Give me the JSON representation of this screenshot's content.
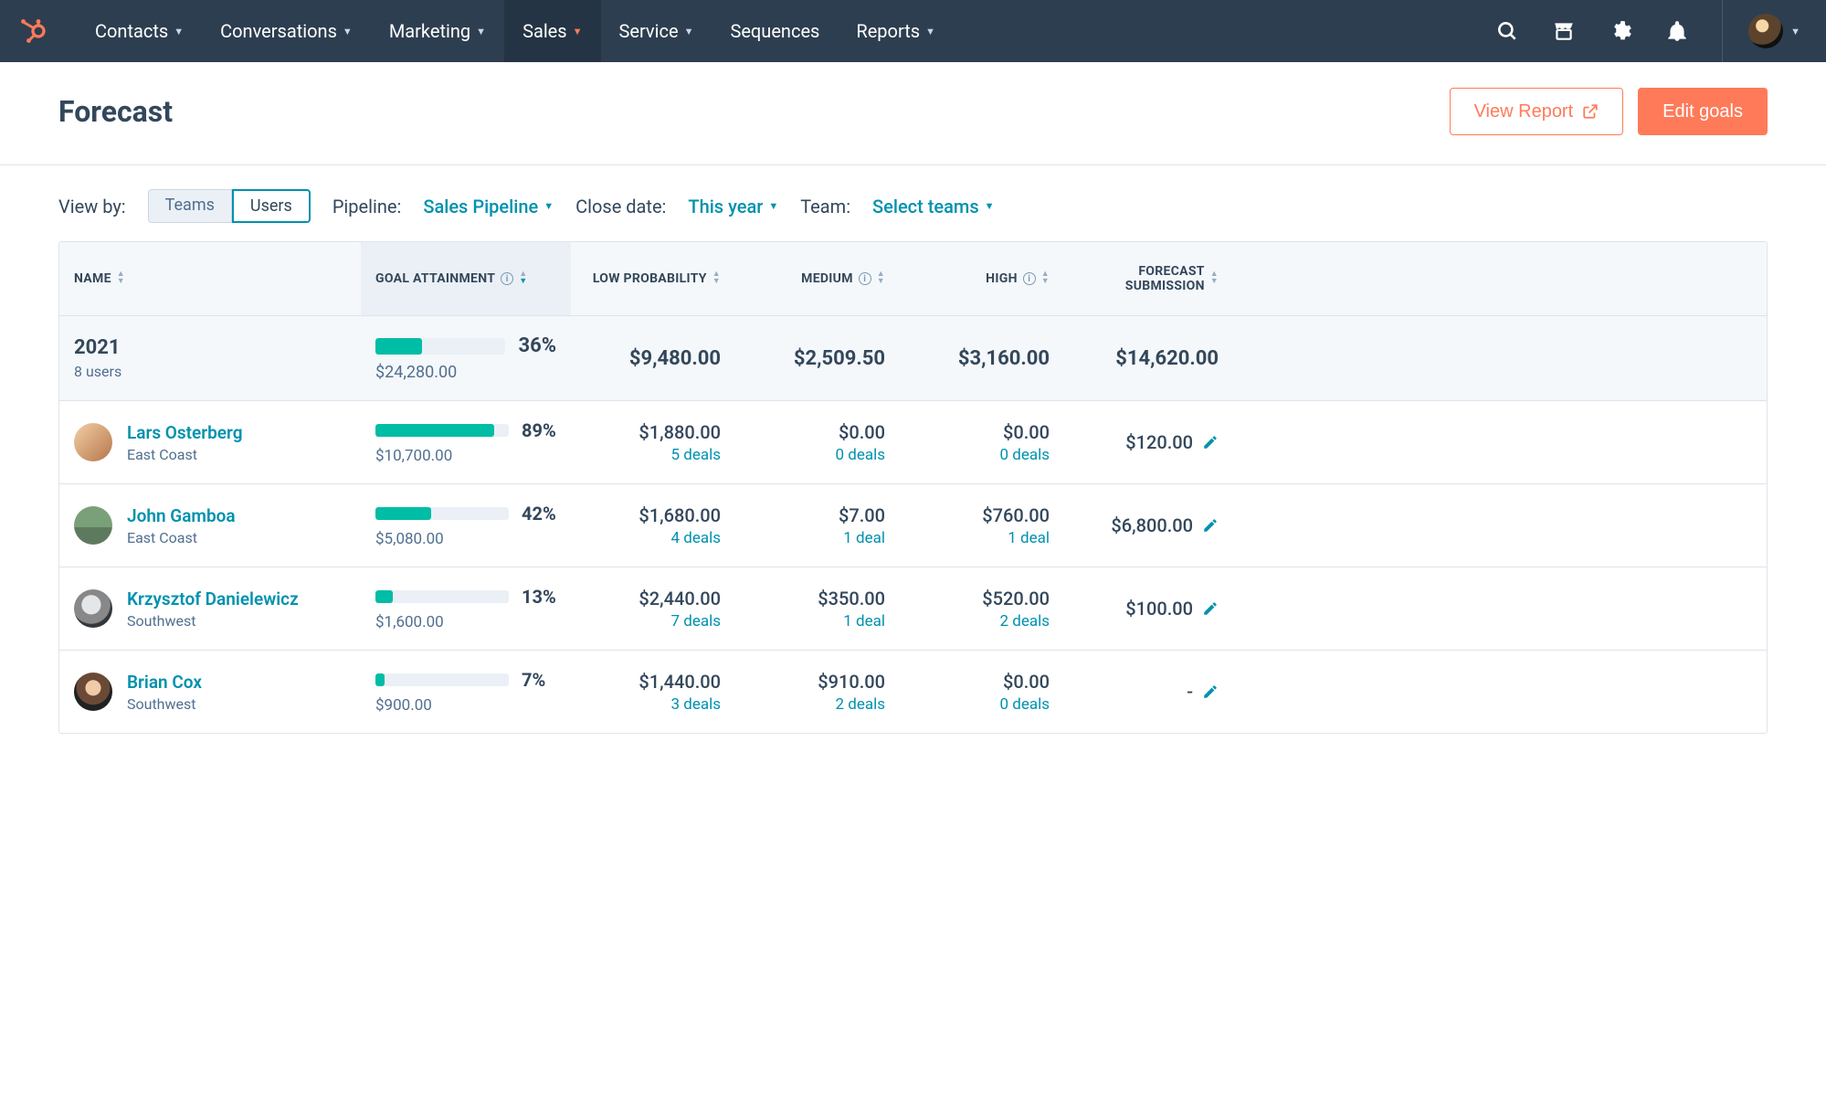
{
  "nav": {
    "items": [
      "Contacts",
      "Conversations",
      "Marketing",
      "Sales",
      "Service",
      "Sequences",
      "Reports"
    ],
    "active_index": 3
  },
  "page": {
    "title": "Forecast",
    "view_report": "View Report",
    "edit_goals": "Edit goals"
  },
  "filters": {
    "view_by_label": "View by:",
    "seg_teams": "Teams",
    "seg_users": "Users",
    "pipeline_label": "Pipeline:",
    "pipeline_value": "Sales Pipeline",
    "close_date_label": "Close date:",
    "close_date_value": "This year",
    "team_label": "Team:",
    "team_value": "Select teams"
  },
  "columns": {
    "name": "NAME",
    "goal": "GOAL ATTAINMENT",
    "low": "LOW PROBABILITY",
    "medium": "MEDIUM",
    "high": "HIGH",
    "forecast": "FORECAST SUBMISSION"
  },
  "summary": {
    "year": "2021",
    "users": "8 users",
    "goal_pct": "36%",
    "goal_pct_num": 36,
    "goal_amount": "$24,280.00",
    "low": "$9,480.00",
    "medium": "$2,509.50",
    "high": "$3,160.00",
    "forecast": "$14,620.00"
  },
  "rows": [
    {
      "name": "Lars Osterberg",
      "region": "East Coast",
      "goal_pct": "89%",
      "goal_pct_num": 89,
      "goal_amount": "$10,700.00",
      "low": "$1,880.00",
      "low_deals": "5 deals",
      "medium": "$0.00",
      "medium_deals": "0 deals",
      "high": "$0.00",
      "high_deals": "0 deals",
      "forecast": "$120.00"
    },
    {
      "name": "John Gamboa",
      "region": "East Coast",
      "goal_pct": "42%",
      "goal_pct_num": 42,
      "goal_amount": "$5,080.00",
      "low": "$1,680.00",
      "low_deals": "4 deals",
      "medium": "$7.00",
      "medium_deals": "1 deal",
      "high": "$760.00",
      "high_deals": "1 deal",
      "forecast": "$6,800.00"
    },
    {
      "name": "Krzysztof Danielewicz",
      "region": "Southwest",
      "goal_pct": "13%",
      "goal_pct_num": 13,
      "goal_amount": "$1,600.00",
      "low": "$2,440.00",
      "low_deals": "7 deals",
      "medium": "$350.00",
      "medium_deals": "1 deal",
      "high": "$520.00",
      "high_deals": "2 deals",
      "forecast": "$100.00"
    },
    {
      "name": "Brian Cox",
      "region": "Southwest",
      "goal_pct": "7%",
      "goal_pct_num": 7,
      "goal_amount": "$900.00",
      "low": "$1,440.00",
      "low_deals": "3 deals",
      "medium": "$910.00",
      "medium_deals": "2 deals",
      "high": "$0.00",
      "high_deals": "0 deals",
      "forecast": "-"
    }
  ]
}
